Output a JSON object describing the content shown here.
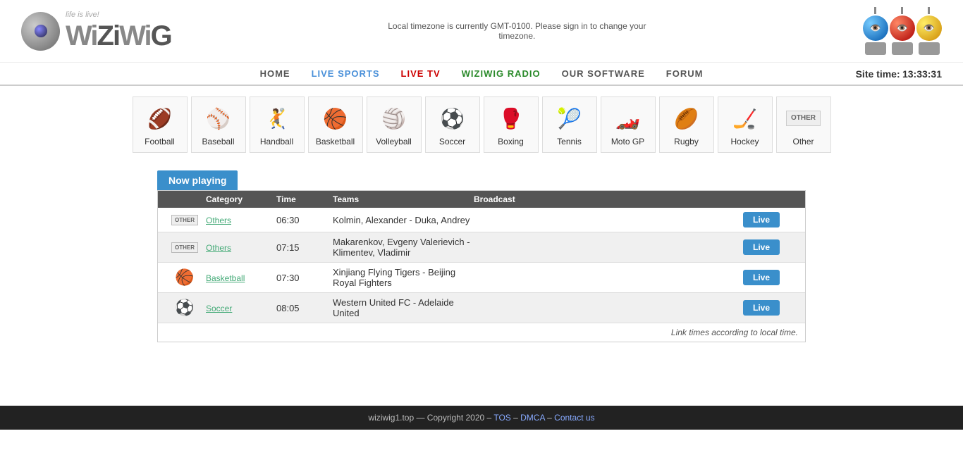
{
  "header": {
    "tagline": "life is live!",
    "timezone_notice": "Local timezone is currently GMT-0100. Please sign in to change your timezone.",
    "logo_alt": "WiziWig"
  },
  "nav": {
    "items": [
      {
        "label": "HOME",
        "class": "home",
        "url": "#"
      },
      {
        "label": "LIVE SPORTS",
        "class": "live-sports",
        "url": "#"
      },
      {
        "label": "LIVE TV",
        "class": "live-tv",
        "url": "#"
      },
      {
        "label": "WIZIWIG RADIO",
        "class": "wiziwig-radio",
        "url": "#"
      },
      {
        "label": "OUR SOFTWARE",
        "class": "our-software",
        "url": "#"
      },
      {
        "label": "FORUM",
        "class": "forum",
        "url": "#"
      }
    ],
    "site_time_label": "Site time:",
    "site_time_value": "13:33:31"
  },
  "sports": [
    {
      "label": "Football",
      "icon": "🏈"
    },
    {
      "label": "Baseball",
      "icon": "⚾"
    },
    {
      "label": "Handball",
      "icon": "🤾"
    },
    {
      "label": "Basketball",
      "icon": "🏀"
    },
    {
      "label": "Volleyball",
      "icon": "🏐"
    },
    {
      "label": "Soccer",
      "icon": "⚽"
    },
    {
      "label": "Boxing",
      "icon": "🥊"
    },
    {
      "label": "Tennis",
      "icon": "🎾"
    },
    {
      "label": "Moto GP",
      "icon": "🏎️"
    },
    {
      "label": "Rugby",
      "icon": "🏉"
    },
    {
      "label": "Hockey",
      "icon": "🏒"
    },
    {
      "label": "Other",
      "icon": "OTHER"
    }
  ],
  "now_playing": {
    "tab_label": "Now playing",
    "columns": {
      "category_img": "",
      "category": "Category",
      "time": "Time",
      "teams": "Teams",
      "broadcast": "Broadcast",
      "action": ""
    },
    "rows": [
      {
        "icon": "OTHER",
        "category": "Others",
        "time": "06:30",
        "teams": "Kolmin, Alexander - Duka, Andrey",
        "broadcast": "",
        "live_label": "Live"
      },
      {
        "icon": "OTHER",
        "category": "Others",
        "time": "07:15",
        "teams": "Makarenkov, Evgeny Valerievich - Klimentev, Vladimir",
        "broadcast": "",
        "live_label": "Live"
      },
      {
        "icon": "🏀",
        "category": "Basketball",
        "time": "07:30",
        "teams": "Xinjiang Flying Tigers - Beijing Royal Fighters",
        "broadcast": "",
        "live_label": "Live"
      },
      {
        "icon": "⚽",
        "category": "Soccer",
        "time": "08:05",
        "teams": "Western United FC - Adelaide United",
        "broadcast": "",
        "live_label": "Live"
      }
    ],
    "link_times_note": "Link times according to local time."
  },
  "footer": {
    "text": "wiziwig1.top — Copyright 2020 –",
    "links": [
      {
        "label": "TOS",
        "url": "#"
      },
      {
        "label": "DMCA",
        "url": "#"
      },
      {
        "label": "Contact us",
        "url": "#"
      }
    ]
  }
}
